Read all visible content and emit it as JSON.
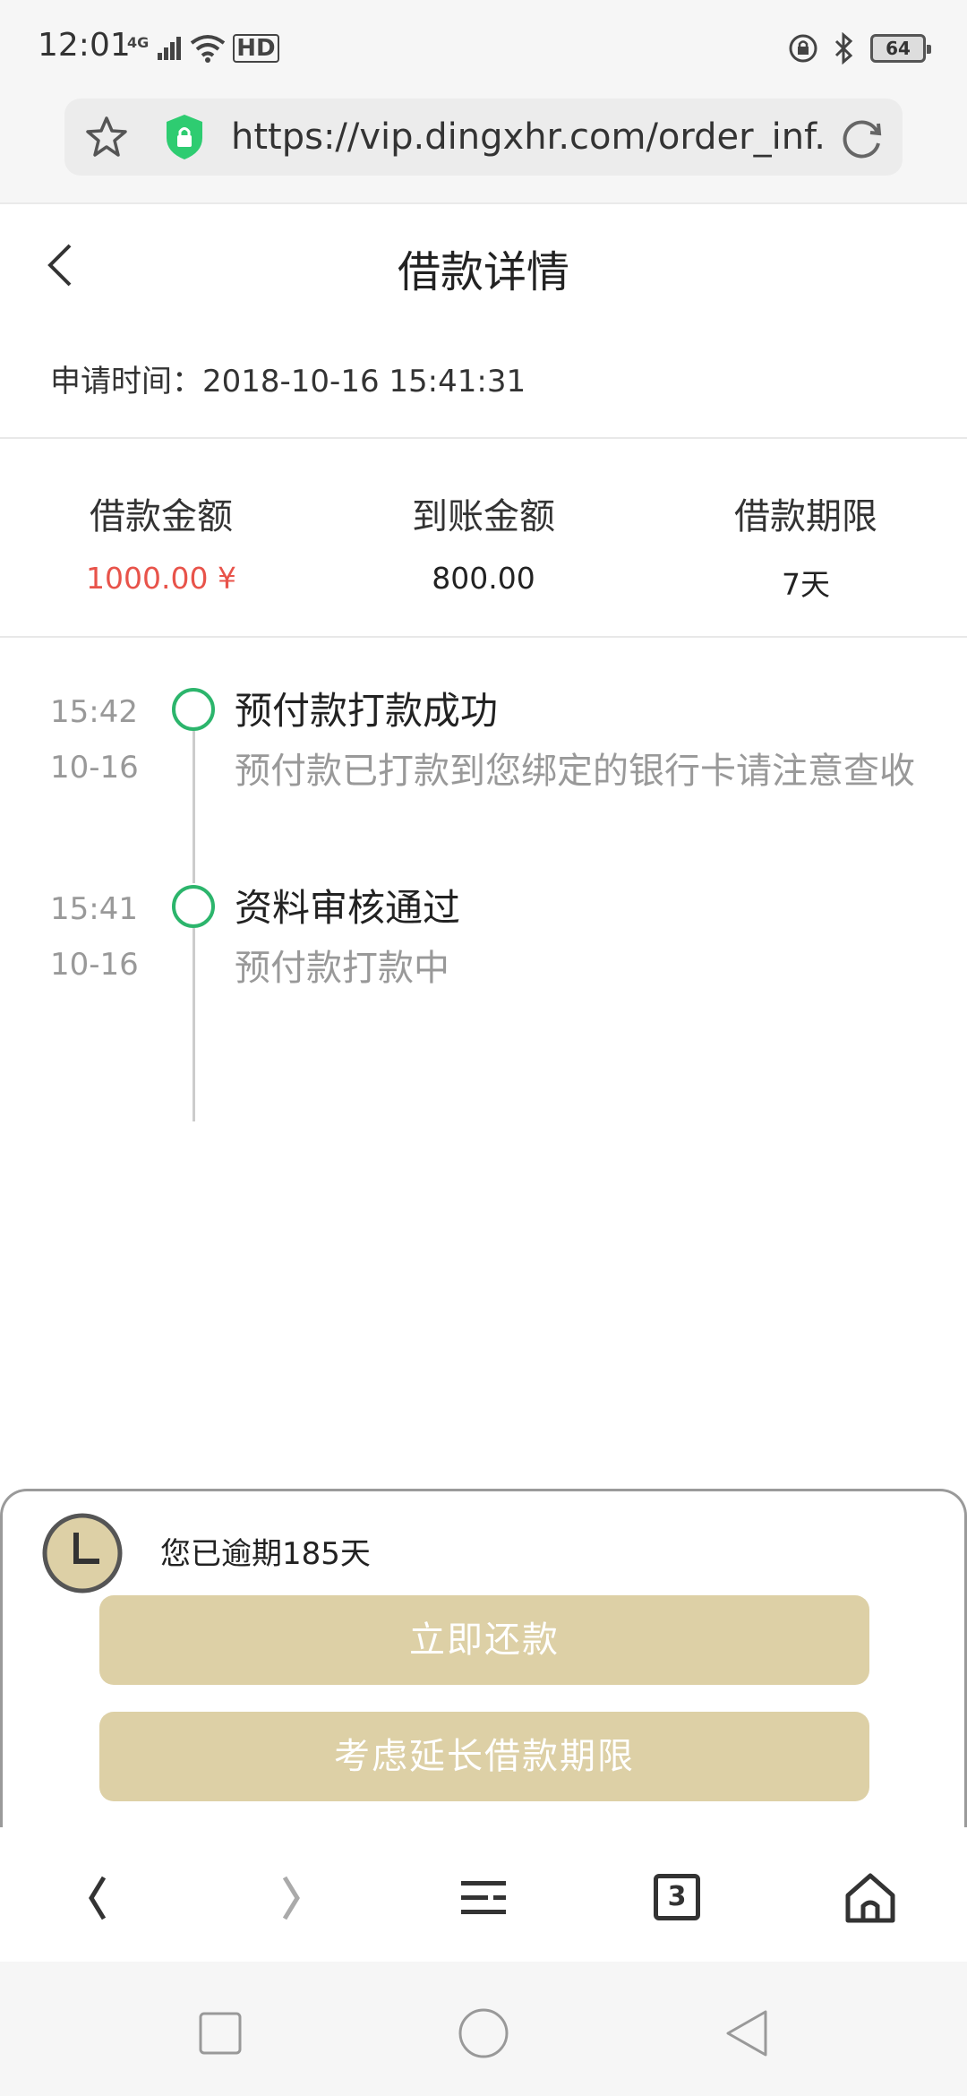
{
  "status_bar": {
    "time": "12:01",
    "network": "4G",
    "hd": "HD",
    "battery": "64"
  },
  "url_bar": {
    "url": "https://vip.dingxhr.com/order_inf..."
  },
  "header": {
    "title": "借款详情"
  },
  "apply": {
    "text": "申请时间：2018-10-16 15:41:31"
  },
  "summary": {
    "items": [
      {
        "label": "借款金额",
        "value": "1000.00 ¥"
      },
      {
        "label": "到账金额",
        "value": "800.00"
      },
      {
        "label": "借款期限",
        "value": "7天"
      }
    ]
  },
  "timeline": {
    "items": [
      {
        "time": "15:42",
        "date": "10-16",
        "title": "预付款打款成功",
        "desc": "预付款已打款到您绑定的银行卡请注意查收"
      },
      {
        "time": "15:41",
        "date": "10-16",
        "title": "资料审核通过",
        "desc": "预付款打款中"
      }
    ]
  },
  "overdue": {
    "text": "您已逾期185天",
    "repay_label": "立即还款",
    "extend_label": "考虑延长借款期限"
  },
  "browser_nav": {
    "tab_count": "3"
  },
  "colors": {
    "accent_red": "#e8534a",
    "timeline_green": "#2cb56c",
    "button_gold": "#ddd0a6"
  }
}
